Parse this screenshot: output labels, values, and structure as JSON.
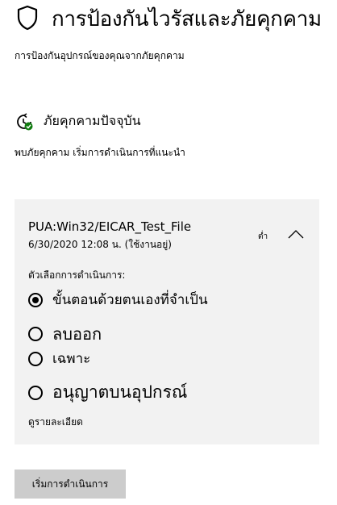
{
  "header": {
    "title": "การป้องกันไวรัสและภัยคุกคาม",
    "icon": "shield-icon"
  },
  "subtitle": "การป้องกันอุปกรณ์ของคุณจากภัยคุกคาม",
  "current_threats": {
    "icon": "clock-check-icon",
    "title": "ภัยคุกคามปัจจุบัน",
    "description": "พบภัยคุกคาม เริ่มการดำเนินการที่แนะนำ"
  },
  "threat_card": {
    "name": "PUA:Win32/EICAR_Test_File",
    "date": "6/30/2020 12:08 น. (ใช้งานอยู่)",
    "severity": "ต่ำ",
    "options_label": "ตัวเลือกการดำเนินการ:",
    "options": [
      {
        "label": "ขั้นตอนด้วยตนเองที่จำเป็น",
        "selected": true
      },
      {
        "label": "ลบออก",
        "selected": false
      },
      {
        "label": "เฉพาะ",
        "selected": false
      },
      {
        "label": "อนุญาตบนอุปกรณ์",
        "selected": false
      }
    ],
    "details_link": "ดูรายละเอียด"
  },
  "action_button": "เริ่มการดำเนินการ",
  "colors": {
    "card_bg": "#f2f2f2",
    "button_bg": "#cccccc",
    "check_green": "#107c10"
  }
}
